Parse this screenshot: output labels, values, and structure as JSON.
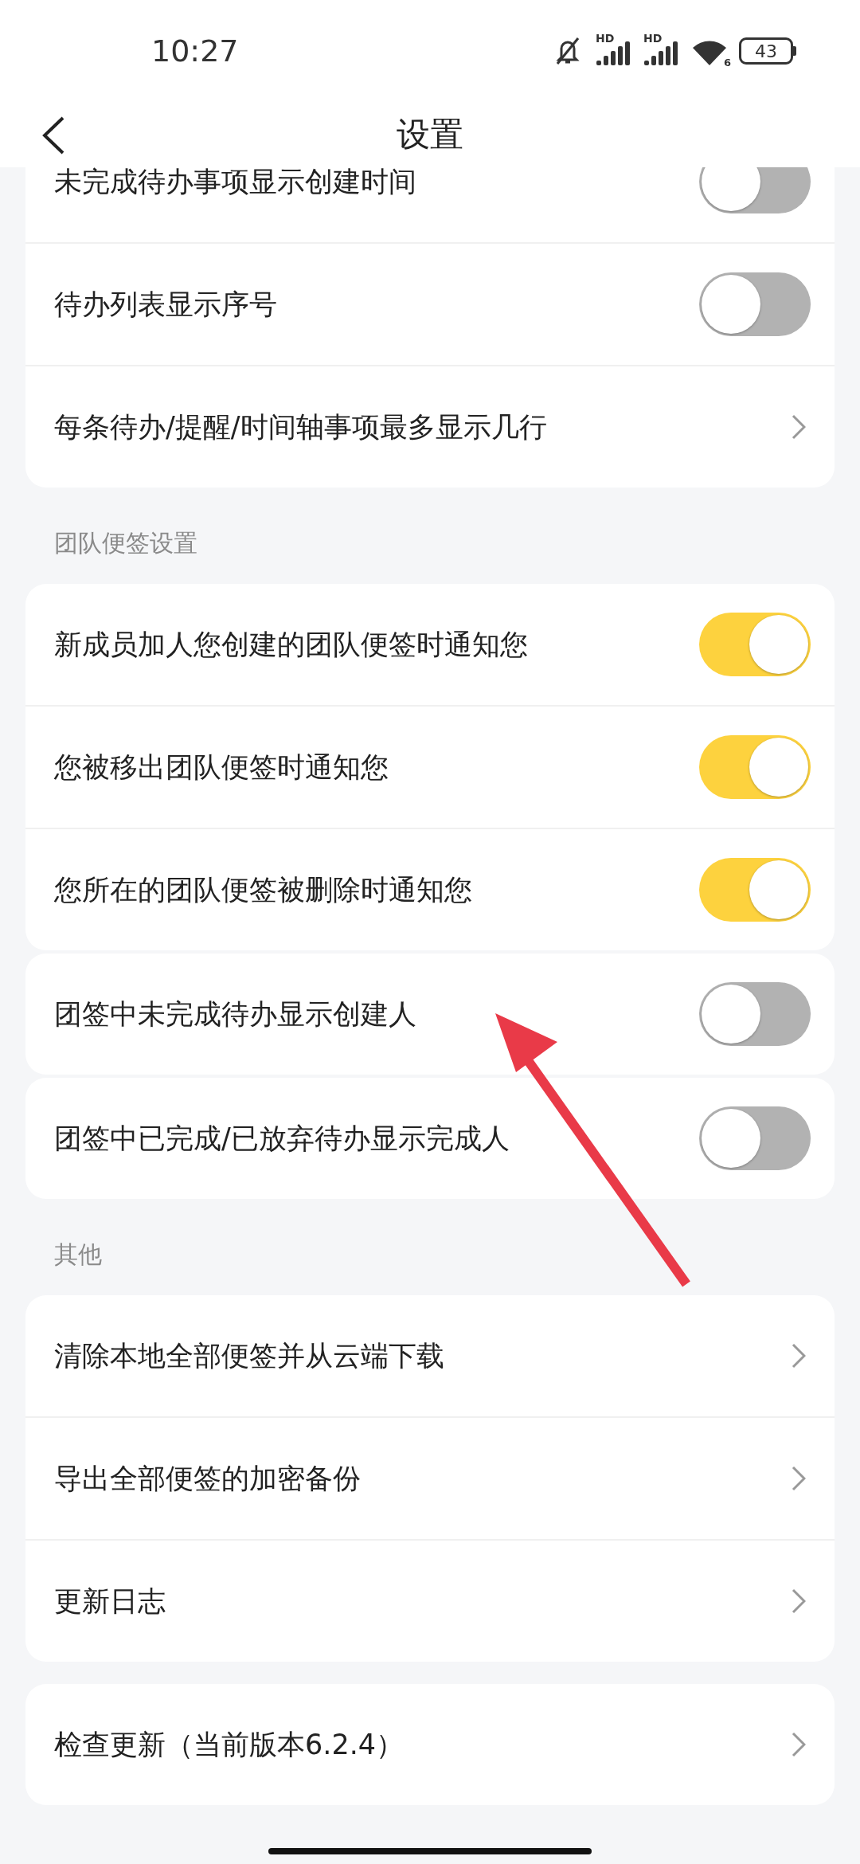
{
  "status_bar": {
    "time": "10:27",
    "hd_labels": [
      "HD",
      "HD"
    ],
    "wifi_label": "6",
    "battery": "43"
  },
  "header": {
    "title": "设置"
  },
  "sections": [
    {
      "cards": [
        [
          {
            "kind": "toggle",
            "label": "未完成待办事项显示创建时间",
            "on": false
          },
          {
            "kind": "toggle",
            "label": "待办列表显示序号",
            "on": false
          },
          {
            "kind": "link",
            "label": "每条待办/提醒/时间轴事项最多显示几行"
          }
        ]
      ]
    },
    {
      "title": "团队便签设置",
      "cards": [
        [
          {
            "kind": "toggle",
            "label": "新成员加人您创建的团队便签时通知您",
            "on": true
          },
          {
            "kind": "toggle",
            "label": "您被移出团队便签时通知您",
            "on": true
          },
          {
            "kind": "toggle",
            "label": "您所在的团队便签被删除时通知您",
            "on": true
          }
        ],
        [
          {
            "kind": "toggle",
            "label": "团签中未完成待办显示创建人",
            "on": false
          }
        ],
        [
          {
            "kind": "toggle",
            "label": "团签中已完成/已放弃待办显示完成人",
            "on": false
          }
        ]
      ]
    },
    {
      "title": "其他",
      "cards": [
        [
          {
            "kind": "link",
            "label": "清除本地全部便签并从云端下载"
          },
          {
            "kind": "link",
            "label": "导出全部便签的加密备份"
          },
          {
            "kind": "link",
            "label": "更新日志"
          }
        ]
      ]
    },
    {
      "cards": [
        [
          {
            "kind": "link",
            "label": "检查更新（当前版本6.2.4）"
          }
        ]
      ]
    }
  ]
}
